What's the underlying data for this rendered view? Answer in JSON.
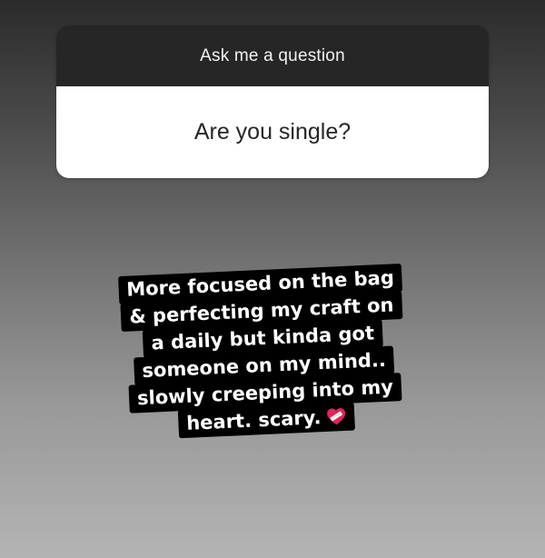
{
  "question_sticker": {
    "prompt": "Ask me a question",
    "question": "Are you single?"
  },
  "answer_text": {
    "lines": [
      "More focused on the bag",
      "& perfecting my craft on",
      "a daily but kinda got",
      "someone on my mind..",
      "slowly creeping into my",
      "heart. scary."
    ],
    "trailing_emoji": "mending-heart-icon"
  },
  "colors": {
    "card_header": "#262626",
    "card_body": "#ffffff",
    "text_highlight": "#000000",
    "heart": "#e0245e"
  }
}
